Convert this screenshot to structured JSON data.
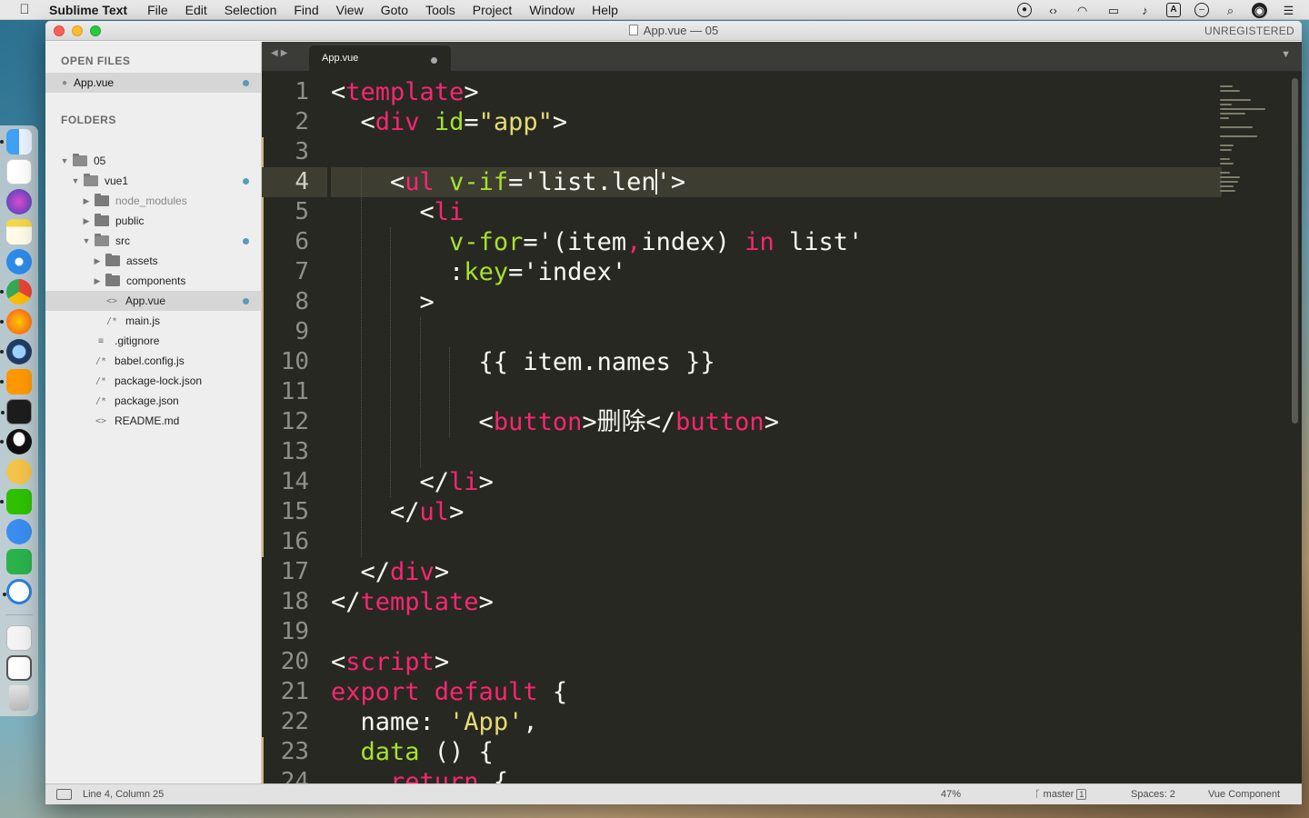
{
  "menubar": {
    "apple": "",
    "app_name": "Sublime Text",
    "items": [
      "File",
      "Edit",
      "Selection",
      "Find",
      "View",
      "Goto",
      "Tools",
      "Project",
      "Window",
      "Help"
    ],
    "input_source": "A"
  },
  "window": {
    "title": "App.vue — 05",
    "registration": "UNREGISTERED"
  },
  "sidebar": {
    "open_files_heading": "OPEN FILES",
    "open_files": [
      {
        "name": "App.vue",
        "modified": true
      }
    ],
    "folders_heading": "FOLDERS",
    "tree": [
      {
        "name": "05",
        "type": "folder",
        "expanded": true,
        "depth": 0
      },
      {
        "name": "vue1",
        "type": "folder",
        "expanded": true,
        "depth": 1,
        "modified": true
      },
      {
        "name": "node_modules",
        "type": "folder",
        "expanded": false,
        "depth": 2
      },
      {
        "name": "public",
        "type": "folder",
        "expanded": false,
        "depth": 2
      },
      {
        "name": "src",
        "type": "folder",
        "expanded": true,
        "depth": 2,
        "modified": true
      },
      {
        "name": "assets",
        "type": "folder",
        "expanded": false,
        "depth": 3
      },
      {
        "name": "components",
        "type": "folder",
        "expanded": false,
        "depth": 3
      },
      {
        "name": "App.vue",
        "type": "file",
        "icon": "<>",
        "depth": 3,
        "selected": true,
        "modified": true
      },
      {
        "name": "main.js",
        "type": "file",
        "icon": "/*",
        "depth": 3
      },
      {
        "name": ".gitignore",
        "type": "file",
        "icon": "≡",
        "depth": 2
      },
      {
        "name": "babel.config.js",
        "type": "file",
        "icon": "/*",
        "depth": 2
      },
      {
        "name": "package-lock.json",
        "type": "file",
        "icon": "/*",
        "depth": 2
      },
      {
        "name": "package.json",
        "type": "file",
        "icon": "/*",
        "depth": 2
      },
      {
        "name": "README.md",
        "type": "file",
        "icon": "<>",
        "depth": 2
      }
    ]
  },
  "editor": {
    "tab_label": "App.vue",
    "current_line": 4,
    "line_numbers": [
      "1",
      "2",
      "3",
      "4",
      "5",
      "6",
      "7",
      "8",
      "9",
      "10",
      "11",
      "12",
      "13",
      "14",
      "15",
      "16",
      "17",
      "18",
      "19",
      "20",
      "21",
      "22",
      "23",
      "24"
    ],
    "code_lines": [
      [
        [
          "pl",
          "<"
        ],
        [
          "tg",
          "template"
        ],
        [
          "pl",
          ">"
        ]
      ],
      [
        [
          "pl",
          "  <"
        ],
        [
          "tg",
          "div"
        ],
        [
          "pl",
          " "
        ],
        [
          "at",
          "id"
        ],
        [
          "pl",
          "="
        ],
        [
          "st",
          "\"app\""
        ],
        [
          "pl",
          ">"
        ]
      ],
      [],
      [
        [
          "pl",
          "    <"
        ],
        [
          "tg",
          "ul"
        ],
        [
          "pl",
          " "
        ],
        [
          "at",
          "v-if"
        ],
        [
          "pl",
          "='list.len"
        ],
        [
          "caret",
          ""
        ],
        [
          "pl",
          "'>"
        ]
      ],
      [
        [
          "pl",
          "      <"
        ],
        [
          "tg",
          "li"
        ]
      ],
      [
        [
          "pl",
          "        "
        ],
        [
          "at",
          "v-for"
        ],
        [
          "pl",
          "='(item"
        ],
        [
          "kw",
          ","
        ],
        [
          "pl",
          "index) "
        ],
        [
          "kw",
          "in"
        ],
        [
          "pl",
          " list'"
        ]
      ],
      [
        [
          "pl",
          "        :"
        ],
        [
          "at",
          "key"
        ],
        [
          "pl",
          "='index'"
        ]
      ],
      [
        [
          "pl",
          "      >"
        ]
      ],
      [],
      [
        [
          "pl",
          "          {{ item.names }}"
        ]
      ],
      [],
      [
        [
          "pl",
          "          <"
        ],
        [
          "tg",
          "button"
        ],
        [
          "pl",
          ">删除</"
        ],
        [
          "tg",
          "button"
        ],
        [
          "pl",
          ">"
        ]
      ],
      [],
      [
        [
          "pl",
          "      </"
        ],
        [
          "tg",
          "li"
        ],
        [
          "pl",
          ">"
        ]
      ],
      [
        [
          "pl",
          "    </"
        ],
        [
          "tg",
          "ul"
        ],
        [
          "pl",
          ">"
        ]
      ],
      [],
      [
        [
          "pl",
          "  </"
        ],
        [
          "tg",
          "div"
        ],
        [
          "pl",
          ">"
        ]
      ],
      [
        [
          "pl",
          "</"
        ],
        [
          "tg",
          "template"
        ],
        [
          "pl",
          ">"
        ]
      ],
      [],
      [
        [
          "pl",
          "<"
        ],
        [
          "tg",
          "script"
        ],
        [
          "pl",
          ">"
        ]
      ],
      [
        [
          "kw",
          "export default"
        ],
        [
          "pl",
          " {"
        ]
      ],
      [
        [
          "pl",
          "  name: "
        ],
        [
          "st",
          "'App'"
        ],
        [
          "pl",
          ","
        ]
      ],
      [
        [
          "at",
          "  data"
        ],
        [
          "pl",
          " () {"
        ]
      ],
      [
        [
          "kw",
          "    return"
        ],
        [
          "pl",
          " {"
        ]
      ]
    ]
  },
  "statusbar": {
    "position": "Line 4, Column 25",
    "percent": "47%",
    "branch": "master",
    "branch_badge": "1",
    "indentation": "Spaces: 2",
    "syntax": "Vue Component"
  },
  "colors": {
    "editor_bg": "#272822",
    "tag": "#f92672",
    "attribute": "#a6e22e",
    "string": "#e6db74",
    "text": "#f8f8f2",
    "line_number": "#8f908a",
    "modified_dot": "#5b9bb5"
  },
  "dock_icons": [
    "finder-icon",
    "calendar-icon",
    "siri-icon",
    "notes-icon",
    "safari-icon",
    "chrome-icon",
    "firefox-icon",
    "quicktime-icon",
    "sublime-text-icon",
    "terminal-icon",
    "qq-icon",
    "squirrel-icon",
    "wechat-icon",
    "feishu-icon",
    "hbuilder-icon",
    "baidu-netdisk-icon",
    "preview-icon",
    "screen-icon",
    "trash-icon"
  ]
}
